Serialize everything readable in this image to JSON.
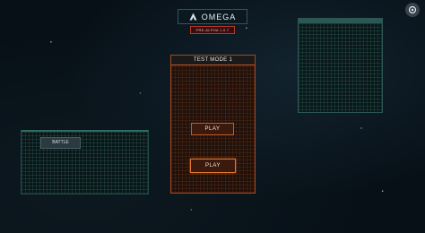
{
  "app": {
    "name": "OMEGA",
    "version": "PRE-ALPHA 1.0.7"
  },
  "battle_panel": {
    "tab_label": "BATTLE"
  },
  "mode_panel": {
    "title": "TEST MODE 1",
    "play_label_1": "PLAY",
    "play_label_2": "PLAY"
  },
  "icons": {
    "logo": "omega-logo-icon",
    "corner": "settings-icon"
  },
  "colors": {
    "accent_orange": "#c25d2a",
    "accent_teal": "#2f6a63",
    "badge_red": "#b33a2e"
  }
}
